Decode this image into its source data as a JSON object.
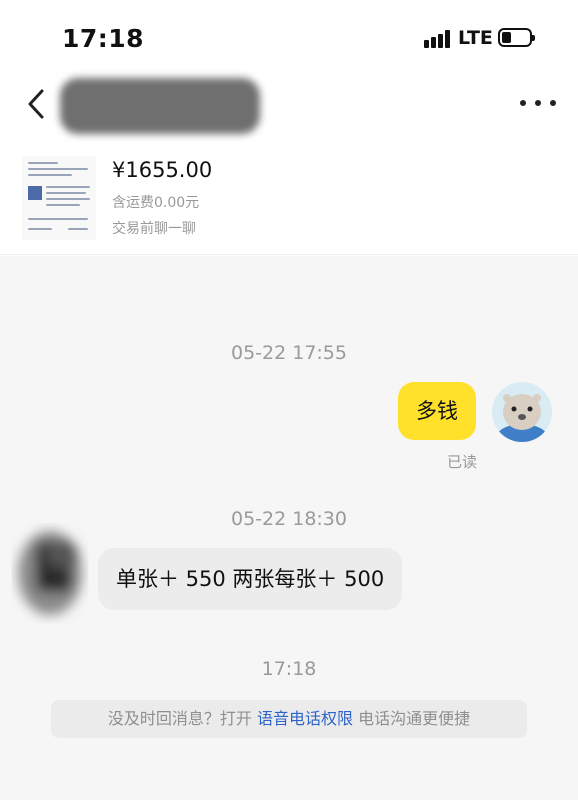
{
  "status_bar": {
    "time": "17:18",
    "network": "LTE"
  },
  "header": {
    "title": ""
  },
  "product": {
    "price": "¥1655.00",
    "shipping": "含运费0.00元",
    "chat_hint": "交易前聊一聊"
  },
  "chat": {
    "messages": [
      {
        "timestamp": "05-22 17:55",
        "sender": "self",
        "text": "多钱",
        "status": "已读"
      },
      {
        "timestamp": "05-22 18:30",
        "sender": "peer",
        "text": "单张＋ 550 两张每张＋ 500"
      }
    ],
    "last_timestamp": "17:18",
    "notice": {
      "prefix": "没及时回消息？打开",
      "link": "语音电话权限",
      "suffix": "电话沟通更便捷"
    }
  },
  "colors": {
    "accent_yellow": "#ffe12c",
    "link_blue": "#2e64c9",
    "chat_background": "#f6f6f6"
  },
  "icons": {
    "back": "back-chevron-icon",
    "more": "more-dots-icon",
    "signal": "cellular-signal-icon",
    "battery": "battery-icon"
  }
}
